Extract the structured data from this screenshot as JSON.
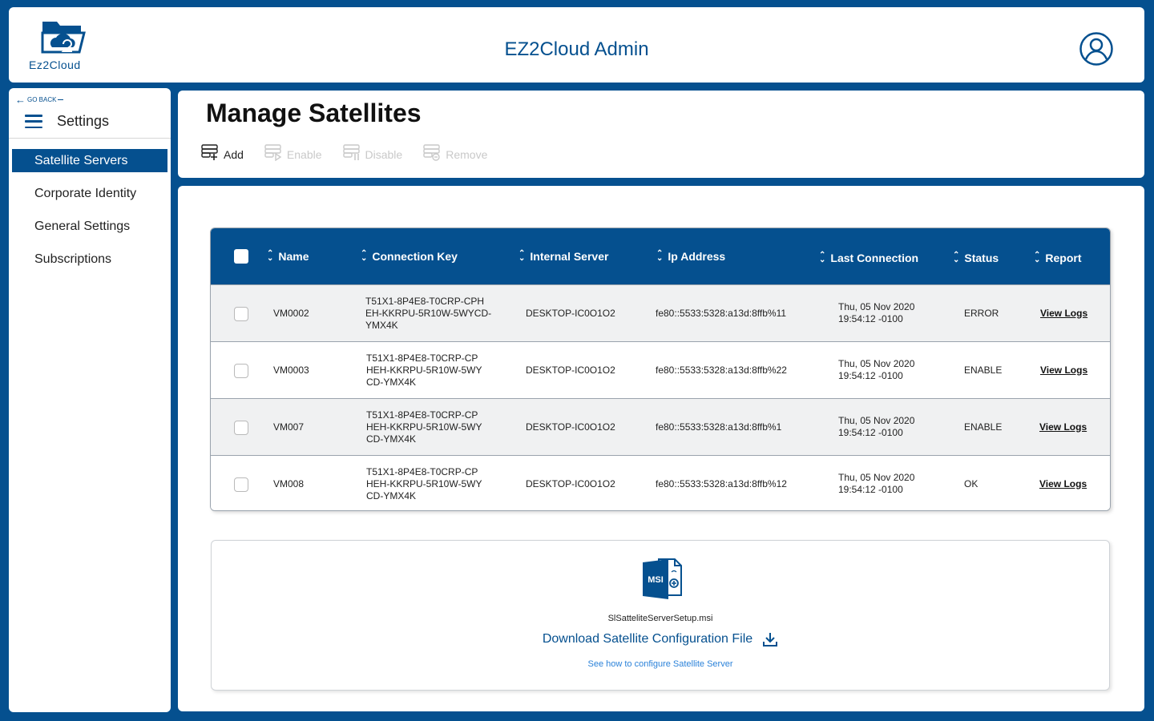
{
  "header": {
    "logo_text": "Ez2Cloud",
    "title": "EZ2Cloud Admin",
    "avatar_icon": "user-circle-icon"
  },
  "sidebar": {
    "go_back": "GO BACK",
    "settings_label": "Settings",
    "items": [
      {
        "label": "Satellite Servers",
        "active": true
      },
      {
        "label": "Corporate Identity",
        "active": false
      },
      {
        "label": "General Settings",
        "active": false
      },
      {
        "label": "Subscriptions",
        "active": false
      }
    ]
  },
  "page": {
    "title": "Manage Satellites",
    "toolbar": {
      "add": "Add",
      "enable": "Enable",
      "disable": "Disable",
      "remove": "Remove"
    }
  },
  "table": {
    "columns": {
      "name": "Name",
      "connection_key": "Connection Key",
      "internal_server": "Internal Server",
      "ip_address": "Ip Address",
      "last_connection": "Last Connection",
      "status": "Status",
      "report": "Report"
    },
    "rows": [
      {
        "name": "VM0002",
        "key1": "T51X1-8P4E8-T0CRP-CPH",
        "key2": "EH-KKRPU-5R10W-5WYCD-",
        "key3": "YMX4K",
        "server": "DESKTOP-IC0O1O2",
        "ip": "fe80::5533:5328:a13d:8ffb%11",
        "date1": "Thu, 05 Nov 2020",
        "date2": "19:54:12 -0100",
        "status": "ERROR",
        "report": "View Logs"
      },
      {
        "name": "VM0003",
        "key1": "T51X1-8P4E8-T0CRP-CP",
        "key2": "HEH-KKRPU-5R10W-5WY",
        "key3": "CD-YMX4K",
        "server": "DESKTOP-IC0O1O2",
        "ip": "fe80::5533:5328:a13d:8ffb%22",
        "date1": "Thu, 05 Nov 2020",
        "date2": "19:54:12 -0100",
        "status": "ENABLE",
        "report": "View Logs"
      },
      {
        "name": "VM007",
        "key1": "T51X1-8P4E8-T0CRP-CP",
        "key2": "HEH-KKRPU-5R10W-5WY",
        "key3": "CD-YMX4K",
        "server": "DESKTOP-IC0O1O2",
        "ip": "fe80::5533:5328:a13d:8ffb%1",
        "date1": "Thu, 05 Nov 2020",
        "date2": "19:54:12 -0100",
        "status": "ENABLE",
        "report": "View Logs"
      },
      {
        "name": "VM008",
        "key1": "T51X1-8P4E8-T0CRP-CP",
        "key2": "HEH-KKRPU-5R10W-5WY",
        "key3": "CD-YMX4K",
        "server": "DESKTOP-IC0O1O2",
        "ip": "fe80::5533:5328:a13d:8ffb%12",
        "date1": "Thu, 05 Nov 2020",
        "date2": "19:54:12 -0100",
        "status": "OK",
        "report": "View Logs"
      }
    ]
  },
  "download": {
    "icon_label": "MSI",
    "filename": "SlSatteliteServerSetup.msi",
    "link": "Download Satellite Configuration File",
    "help": "See how to configure Satellite Server"
  },
  "colors": {
    "brand": "#05508f",
    "link_blue": "#2b82d9"
  }
}
